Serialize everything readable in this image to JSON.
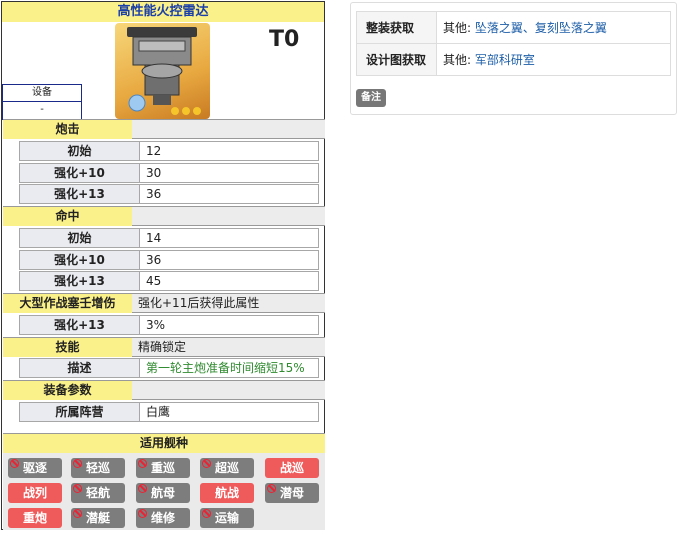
{
  "equipment": {
    "name": "高性能火控雷达",
    "tier": "T0",
    "type_label": "设备",
    "type_value": "-"
  },
  "sections": {
    "firepower": {
      "label": "炮击",
      "rows": [
        {
          "k": "初始",
          "v": "12"
        },
        {
          "k": "强化+10",
          "v": "30"
        },
        {
          "k": "强化+13",
          "v": "36"
        }
      ]
    },
    "accuracy": {
      "label": "命中",
      "rows": [
        {
          "k": "初始",
          "v": "14"
        },
        {
          "k": "强化+10",
          "v": "36"
        },
        {
          "k": "强化+13",
          "v": "45"
        }
      ]
    },
    "oprbonus": {
      "label": "大型作战塞壬增伤",
      "value": "强化+11后获得此属性",
      "rows": [
        {
          "k": "强化+13",
          "v": "3%"
        }
      ]
    },
    "skill": {
      "label": "技能",
      "value": "精确锁定",
      "desc_key": "描述",
      "desc": "第一轮主炮准备时间缩短15%"
    },
    "params": {
      "label": "装备参数",
      "faction_key": "所属阵营",
      "faction": "白鹰"
    },
    "ships_label": "适用舰种"
  },
  "ship_types": [
    {
      "name": "驱逐",
      "allowed": false
    },
    {
      "name": "轻巡",
      "allowed": false
    },
    {
      "name": "重巡",
      "allowed": false
    },
    {
      "name": "超巡",
      "allowed": false
    },
    {
      "name": "战巡",
      "allowed": true
    },
    {
      "name": "战列",
      "allowed": true
    },
    {
      "name": "轻航",
      "allowed": false
    },
    {
      "name": "航母",
      "allowed": false
    },
    {
      "name": "航战",
      "allowed": true
    },
    {
      "name": "潜母",
      "allowed": false
    },
    {
      "name": "重炮",
      "allowed": true
    },
    {
      "name": "潜艇",
      "allowed": false
    },
    {
      "name": "维修",
      "allowed": false
    },
    {
      "name": "运输",
      "allowed": false
    }
  ],
  "colors": {
    "allowed": "#ef5b5b",
    "disallowed": "#7d7d7d",
    "title_bg": "#fbf18a",
    "title_text": "#1a3fa8"
  },
  "acquisition": {
    "rows": [
      {
        "k": "整装获取",
        "prefix": "其他: ",
        "links": "坠落之翼、复刻坠落之翼"
      },
      {
        "k": "设计图获取",
        "prefix": "其他: ",
        "links": "军部科研室"
      }
    ],
    "note_label": "备注"
  }
}
